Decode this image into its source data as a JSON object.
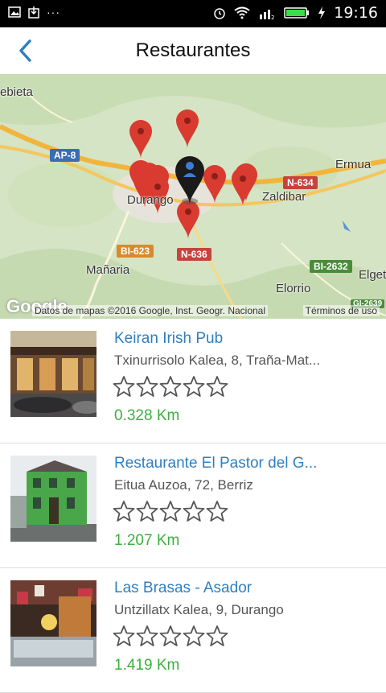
{
  "status_bar": {
    "time": "19:16",
    "signal_sub": "R",
    "signal_sim": "2",
    "dots": "···"
  },
  "app_bar": {
    "title": "Restaurantes",
    "back_icon": "chevron-left-icon"
  },
  "map": {
    "places": [
      "ebieta",
      "Ermua",
      "Zaldibar",
      "Durango",
      "Mañaria",
      "Elorrio",
      "Elget"
    ],
    "roads": [
      "AP-8",
      "N-634",
      "BI-623",
      "N-636",
      "BI-2632",
      "GI-2639"
    ],
    "google_logo": "Google",
    "attribution": "Datos de mapas ©2016 Google, Inst. Geogr. Nacional",
    "terms": "Términos de uso",
    "colors": {
      "pin": "#d93b30",
      "user_pin": "#1a1a1a",
      "highway": "#f2b43a",
      "land": "#d4e4c4"
    }
  },
  "restaurants": [
    {
      "name": "Keiran Irish Pub",
      "address": "Txinurrisolo Kalea, 8, Traña-Mat...",
      "rating": 0,
      "distance": "0.328 Km"
    },
    {
      "name": "Restaurante El Pastor del G...",
      "address": "Eitua Auzoa, 72, Berriz",
      "rating": 0,
      "distance": "1.207 Km"
    },
    {
      "name": "Las Brasas - Asador",
      "address": "Untzillatx Kalea, 9, Durango",
      "rating": 0,
      "distance": "1.419 Km"
    }
  ],
  "colors": {
    "accent": "#2f7fc0",
    "distance": "#3caf3c"
  }
}
